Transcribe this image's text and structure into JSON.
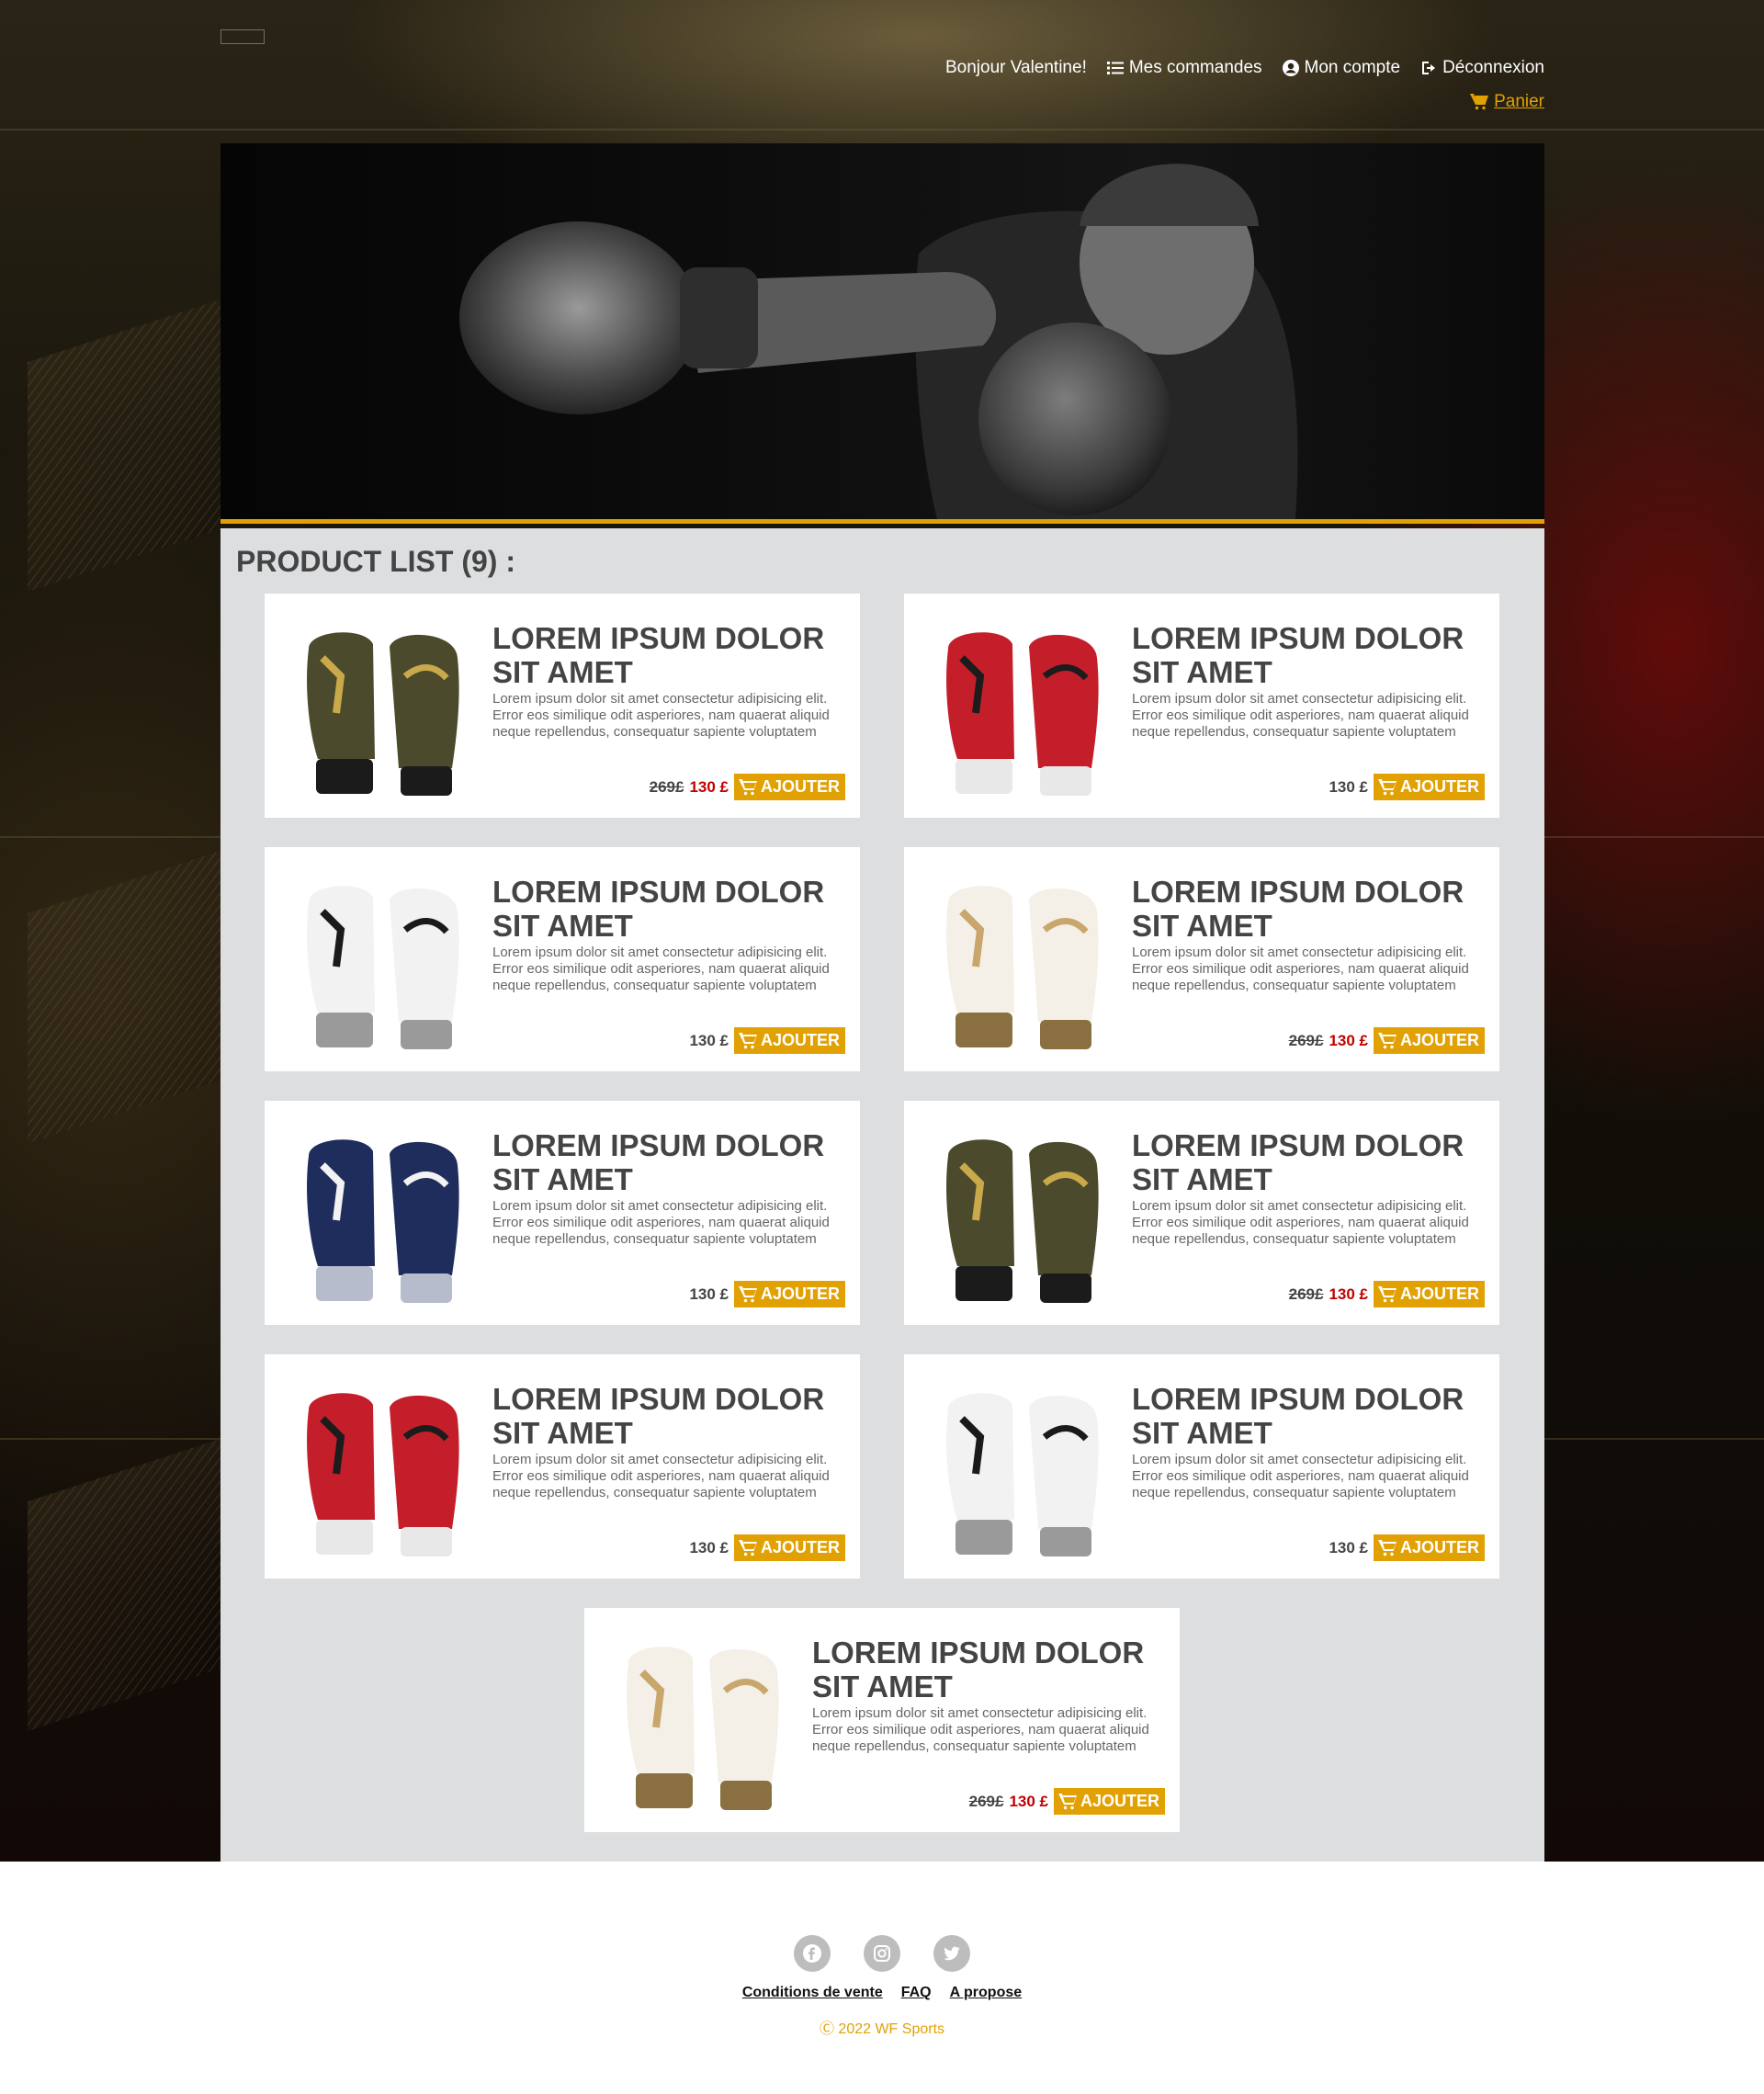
{
  "header": {
    "greeting": "Bonjour Valentine!",
    "orders_label": "Mes commandes",
    "account_label": "Mon compte",
    "logout_label": "Déconnexion",
    "cart_label": "Panier"
  },
  "product_list": {
    "title": "PRODUCT LIST (9) :",
    "add_label": "AJOUTER",
    "items": [
      {
        "title": "LOREM IPSUM DOLOR SIT AMET",
        "description": "Lorem ipsum dolor sit amet consectetur adipisicing elit. Error eos similique odit asperiores, nam quaerat aliquid neque repellendus, consequatur sapiente voluptatem",
        "old_price": "269£",
        "price": "130 £",
        "glove_color": "olive-gold"
      },
      {
        "title": "LOREM IPSUM DOLOR SIT AMET",
        "description": "Lorem ipsum dolor sit amet consectetur adipisicing elit. Error eos similique odit asperiores, nam quaerat aliquid neque repellendus, consequatur sapiente voluptatem",
        "old_price": "",
        "price": "130 £",
        "glove_color": "red-black"
      },
      {
        "title": "LOREM IPSUM DOLOR SIT AMET",
        "description": "Lorem ipsum dolor sit amet consectetur adipisicing elit. Error eos similique odit asperiores, nam quaerat aliquid neque repellendus, consequatur sapiente voluptatem",
        "old_price": "",
        "price": "130 £",
        "glove_color": "white-black"
      },
      {
        "title": "LOREM IPSUM DOLOR SIT AMET",
        "description": "Lorem ipsum dolor sit amet consectetur adipisicing elit. Error eos similique odit asperiores, nam quaerat aliquid neque repellendus, consequatur sapiente voluptatem",
        "old_price": "269£",
        "price": "130 £",
        "glove_color": "white-gold"
      },
      {
        "title": "LOREM IPSUM DOLOR SIT AMET",
        "description": "Lorem ipsum dolor sit amet consectetur adipisicing elit. Error eos similique odit asperiores, nam quaerat aliquid neque repellendus, consequatur sapiente voluptatem",
        "old_price": "",
        "price": "130 £",
        "glove_color": "navy-white"
      },
      {
        "title": "LOREM IPSUM DOLOR SIT AMET",
        "description": "Lorem ipsum dolor sit amet consectetur adipisicing elit. Error eos similique odit asperiores, nam quaerat aliquid neque repellendus, consequatur sapiente voluptatem",
        "old_price": "269£",
        "price": "130 £",
        "glove_color": "olive-gold"
      },
      {
        "title": "LOREM IPSUM DOLOR SIT AMET",
        "description": "Lorem ipsum dolor sit amet consectetur adipisicing elit. Error eos similique odit asperiores, nam quaerat aliquid neque repellendus, consequatur sapiente voluptatem",
        "old_price": "",
        "price": "130 £",
        "glove_color": "red-black"
      },
      {
        "title": "LOREM IPSUM DOLOR SIT AMET",
        "description": "Lorem ipsum dolor sit amet consectetur adipisicing elit. Error eos similique odit asperiores, nam quaerat aliquid neque repellendus, consequatur sapiente voluptatem",
        "old_price": "",
        "price": "130 £",
        "glove_color": "white-black"
      },
      {
        "title": "LOREM IPSUM DOLOR SIT AMET",
        "description": "Lorem ipsum dolor sit amet consectetur adipisicing elit. Error eos similique odit asperiores, nam quaerat aliquid neque repellendus, consequatur sapiente voluptatem",
        "old_price": "269£",
        "price": "130 £",
        "glove_color": "white-gold"
      }
    ]
  },
  "footer": {
    "social_icons": [
      "facebook-icon",
      "instagram-icon",
      "twitter-icon"
    ],
    "links": [
      "Conditions de vente",
      "FAQ",
      "A propose"
    ],
    "copyright": "Ⓒ 2022 WF Sports"
  },
  "colors": {
    "accent": "#e2a102",
    "sale_price": "#c00000",
    "content_bg": "#dcdedf",
    "heading": "#444444"
  }
}
